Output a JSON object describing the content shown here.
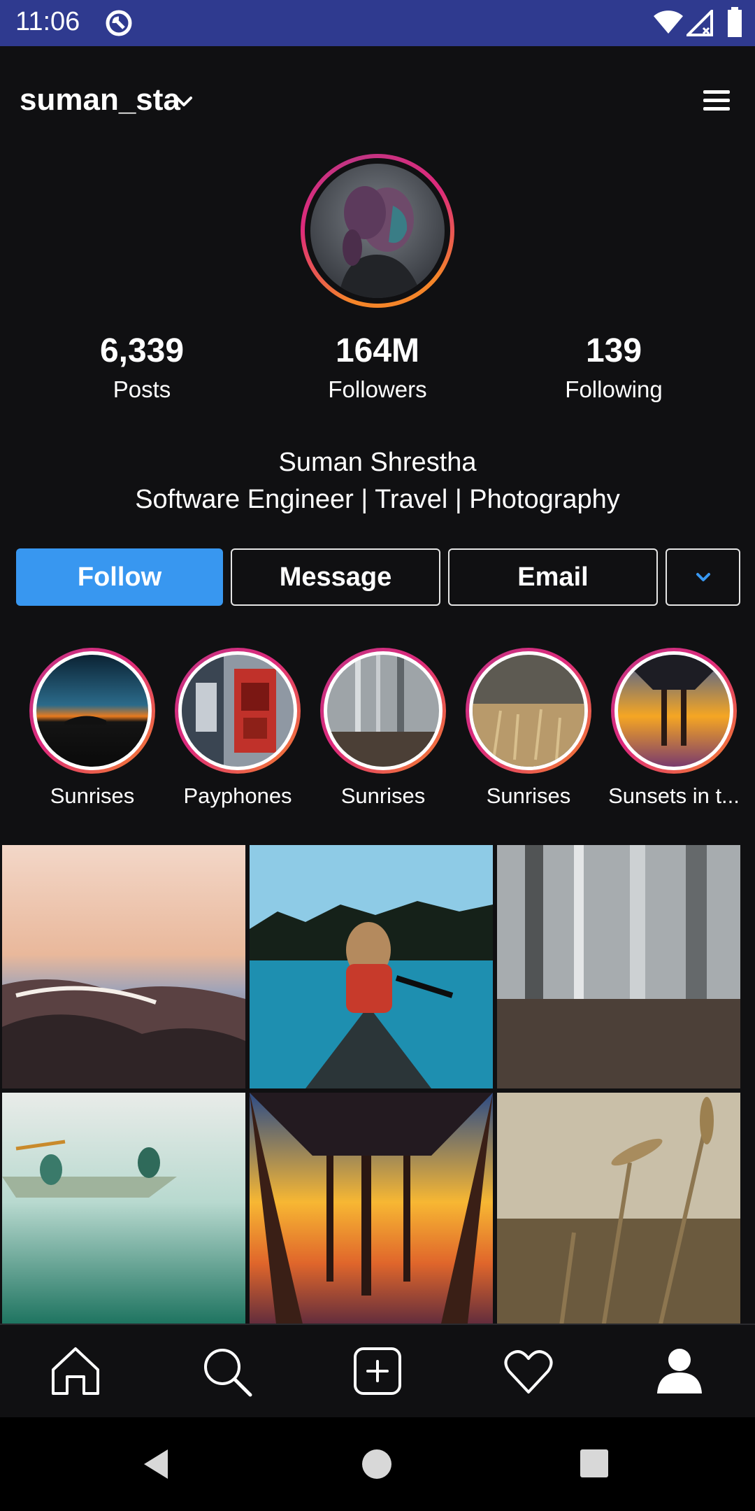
{
  "status_bar": {
    "time": "11:06"
  },
  "header": {
    "username": "suman_sta"
  },
  "stats": [
    {
      "value": "6,339",
      "label": "Posts"
    },
    {
      "value": "164M",
      "label": "Followers"
    },
    {
      "value": "139",
      "label": "Following"
    }
  ],
  "profile": {
    "full_name": "Suman Shrestha",
    "bio": "Software Engineer | Travel | Photography"
  },
  "actions": {
    "follow": "Follow",
    "message": "Message",
    "email": "Email"
  },
  "highlights": [
    {
      "label": "Sunrises"
    },
    {
      "label": "Payphones"
    },
    {
      "label": "Sunrises"
    },
    {
      "label": "Sunrises"
    },
    {
      "label": "Sunsets in t..."
    }
  ],
  "colors": {
    "accent": "#3897f0",
    "status_bar": "#2f3a8f",
    "background": "#101012"
  },
  "nav": {
    "icons": [
      "home-icon",
      "search-icon",
      "add-post-icon",
      "heart-icon",
      "profile-icon"
    ]
  }
}
